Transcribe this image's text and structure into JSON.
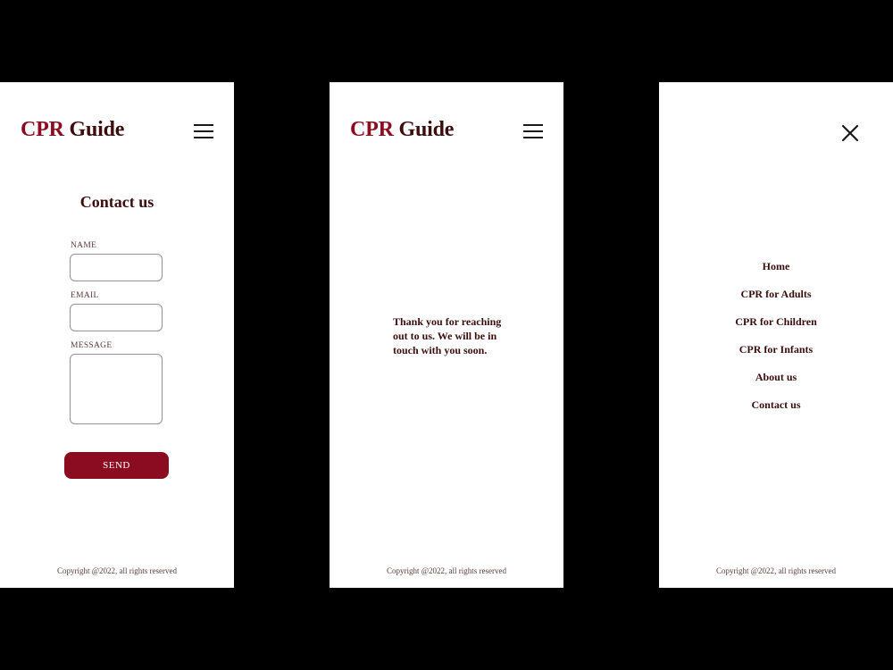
{
  "colors": {
    "brand": "#8b0c20",
    "text_dark": "#3b0d0d",
    "backdrop": "#000000",
    "screen_bg": "#ffffff"
  },
  "logo": {
    "brand": "CPR",
    "rest": " Guide"
  },
  "icons": {
    "menu": "hamburger-menu-icon",
    "close": "close-x-icon"
  },
  "contact_screen": {
    "heading": "Contact us",
    "fields": {
      "name_label": "NAME",
      "name_value": "",
      "email_label": "EMAIL",
      "email_value": "",
      "message_label": "MESSAGE",
      "message_value": ""
    },
    "send_label": "SEND"
  },
  "thanks_screen": {
    "message": "Thank you for reaching out to us. We will be in touch with you soon."
  },
  "menu_screen": {
    "items": [
      "Home",
      "CPR for Adults",
      "CPR for Children",
      "CPR for Infants",
      "About us",
      "Contact us"
    ]
  },
  "footer": {
    "copyright": "Copyright @2022, all rights reserved"
  }
}
